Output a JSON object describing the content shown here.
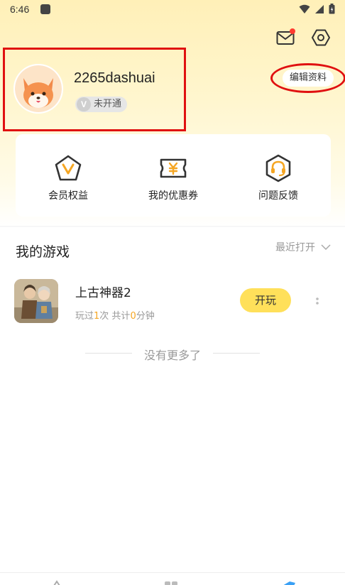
{
  "status_bar": {
    "time": "6:46"
  },
  "profile": {
    "username": "2265dashuai",
    "vip_letter": "V",
    "vip_status": "未开通",
    "edit_label": "编辑资料"
  },
  "actions": [
    {
      "label": "会员权益",
      "icon": "vip-pentagon-icon"
    },
    {
      "label": "我的优惠券",
      "icon": "coupon-icon"
    },
    {
      "label": "问题反馈",
      "icon": "feedback-headset-icon"
    }
  ],
  "my_games": {
    "title": "我的游戏",
    "sort_label": "最近打开",
    "games": [
      {
        "name": "上古神器2",
        "stats_prefix": "玩过",
        "times": "1",
        "stats_mid": "次 共计",
        "minutes": "0",
        "stats_suffix": "分钟",
        "play_label": "开玩"
      }
    ],
    "end_text": "没有更多了"
  },
  "colors": {
    "accent_yellow": "#ffe05a",
    "highlight_orange": "#f5a623",
    "annotation_red": "#e01010"
  }
}
